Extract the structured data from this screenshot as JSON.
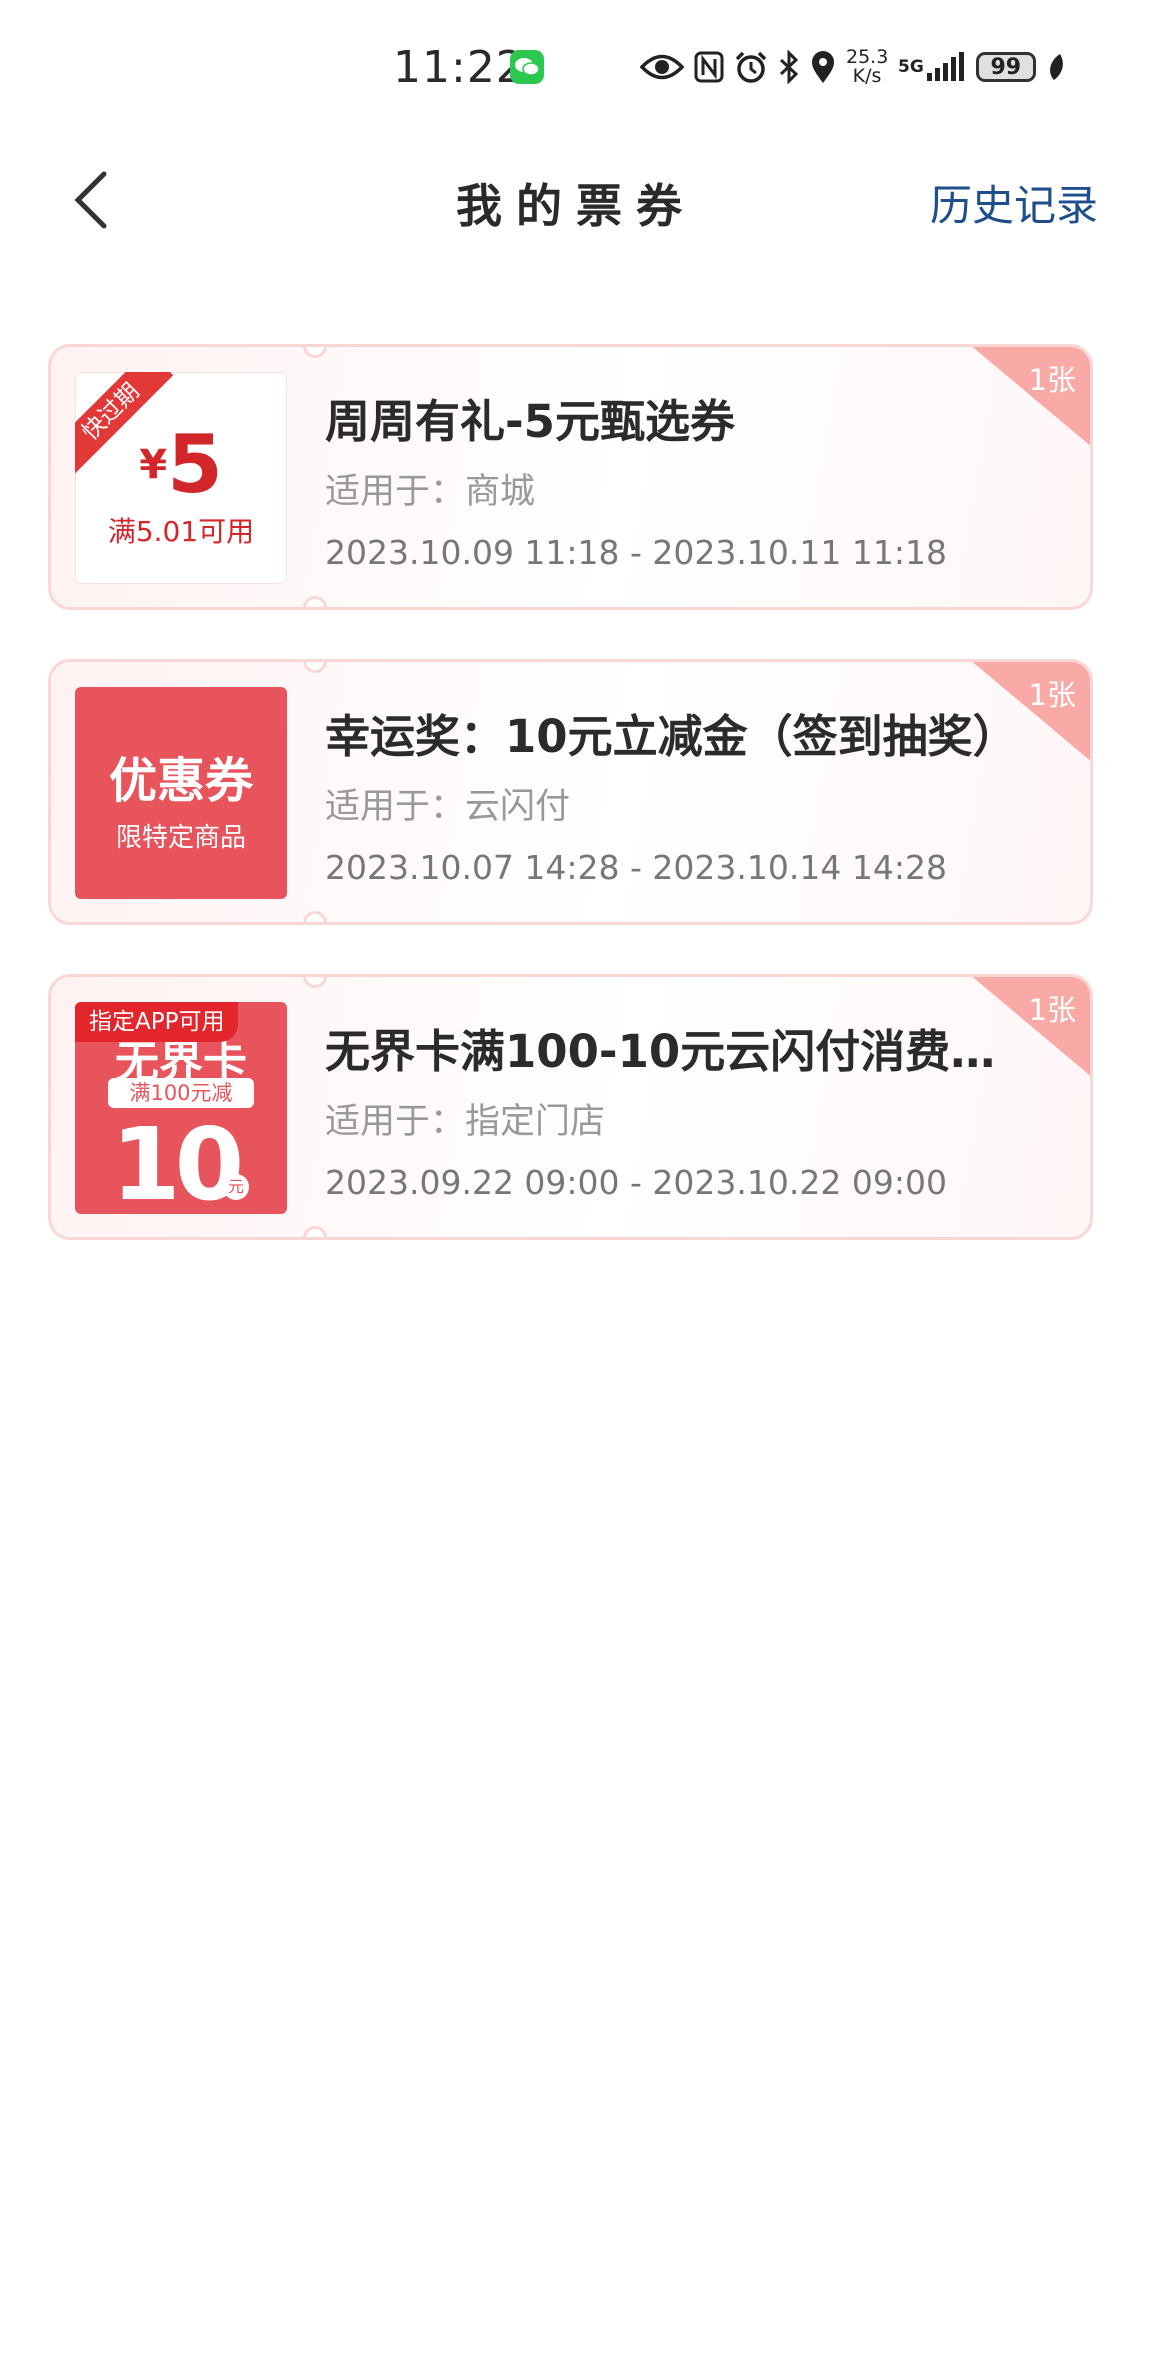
{
  "status_bar": {
    "time": "11:22",
    "net_speed_value": "25.3",
    "net_speed_unit": "K/s",
    "network": "5G",
    "battery": "99"
  },
  "header": {
    "title": "我的票券",
    "history_label": "历史记录"
  },
  "coupons": [
    {
      "thumb": {
        "ribbon": "快过期",
        "currency": "¥",
        "amount": "5",
        "condition": "满5.01可用"
      },
      "count": "1张",
      "title": "周周有礼-5元甄选券",
      "scope": "适用于：商城",
      "validity": "2023.10.09 11:18 - 2023.10.11 11:18"
    },
    {
      "thumb": {
        "main": "优惠券",
        "sub": "限特定商品"
      },
      "count": "1张",
      "title": "幸运奖：10元立减金（签到抽奖）",
      "scope": "适用于：云闪付",
      "validity": "2023.10.07 14:28 - 2023.10.14 14:28"
    },
    {
      "thumb": {
        "tag": "指定APP可用",
        "brand": "无界卡",
        "pill": "满100元减",
        "value": "10",
        "unit": "元"
      },
      "count": "1张",
      "title": "无界卡满100-10元云闪付消费立...",
      "scope": "适用于：指定门店",
      "validity": "2023.09.22 09:00 - 2023.10.22 09:00"
    }
  ],
  "colors": {
    "accent_red": "#d3262a",
    "coupon_red": "#e7545c",
    "link_blue": "#1f4e8c",
    "corner_pink": "#f9aaa7"
  }
}
